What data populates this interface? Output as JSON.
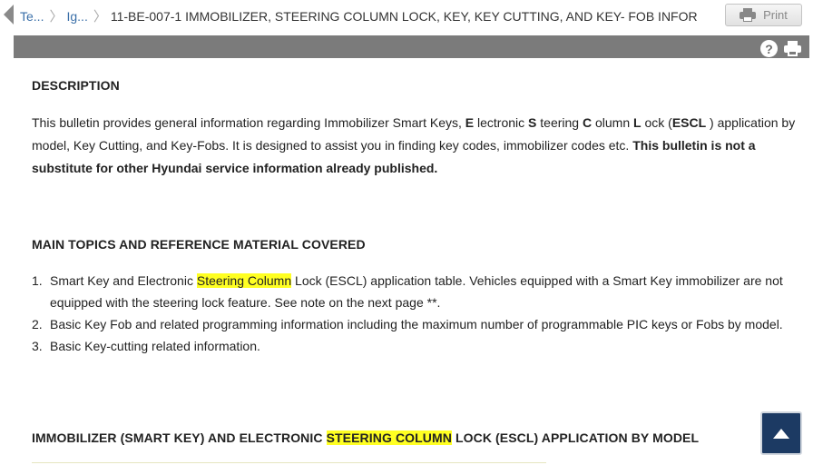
{
  "breadcrumb": {
    "items": [
      "Te...",
      "Ig..."
    ],
    "current": "11-BE-007-1 IMMOBILIZER, STEERING COLUMN LOCK, KEY, KEY CUTTING, AND KEY- FOB INFOR"
  },
  "toolbar": {
    "print_label": "Print"
  },
  "description": {
    "heading": "DESCRIPTION",
    "text_1": "This bulletin provides general information regarding Immobilizer Smart Keys, ",
    "e_bold": "E",
    "text_2": " lectronic ",
    "s_bold": "S",
    "text_3": " teering ",
    "c_bold": "C",
    "text_4": " olumn ",
    "l_bold": "L",
    "text_5": " ock (",
    "escl_bold": "ESCL",
    "text_6": " ) application by model, Key Cutting, and Key-Fobs. It is designed to assist you in finding key codes, immobilizer codes etc. ",
    "bold_sentence": "This bulletin is not a substitute for other Hyundai service information already published."
  },
  "topics": {
    "heading": "MAIN TOPICS AND REFERENCE MATERIAL COVERED",
    "items": [
      {
        "num": "1.",
        "pre": "Smart Key and Electronic ",
        "highlight": "Steering Column",
        "post": " Lock (ESCL) application table. Vehicles equipped with a Smart Key immobilizer are not equipped with the steering lock feature. See note on the next page **."
      },
      {
        "num": "2.",
        "text": "Basic Key Fob and related programming information including the maximum number of programmable PIC keys or Fobs by model."
      },
      {
        "num": "3.",
        "text": "Basic Key-cutting related information."
      }
    ]
  },
  "application": {
    "pre": "IMMOBILIZER (SMART KEY) AND ELECTRONIC ",
    "highlight": "STEERING COLUMN",
    "post": " LOCK (ESCL) APPLICATION BY MODEL"
  },
  "colors": {
    "highlight": "#ffff22",
    "toolbar_bg": "#7b7b7b",
    "scroll_button": "#1c3a63",
    "link": "#3a6fa8"
  }
}
